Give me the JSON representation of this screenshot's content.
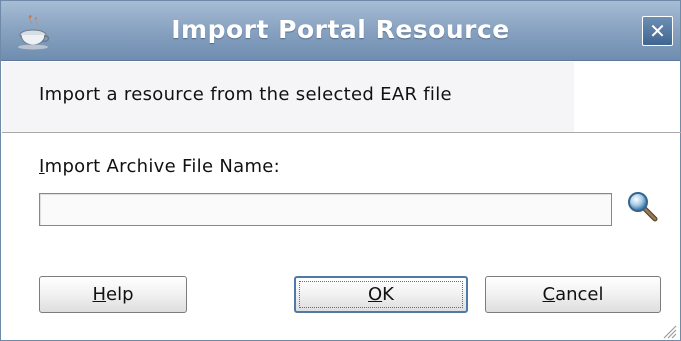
{
  "window": {
    "title": "Import Portal Resource",
    "close_glyph": "✕",
    "icon": "java-cup-icon"
  },
  "header": {
    "text": "Import a resource from the selected EAR file"
  },
  "form": {
    "label_mnemonic": "I",
    "label_rest": "mport Archive File Name:",
    "file_value": "",
    "browse_icon": "magnifier-search-icon"
  },
  "buttons": {
    "help_mnemonic": "H",
    "help_rest": "elp",
    "ok_mnemonic": "O",
    "ok_rest": "K",
    "cancel_mnemonic": "C",
    "cancel_rest": "ancel"
  },
  "colors": {
    "titlebar": "#8aa4c2",
    "title_text": "#ffffff",
    "default_button_border": "#4f79a6"
  }
}
